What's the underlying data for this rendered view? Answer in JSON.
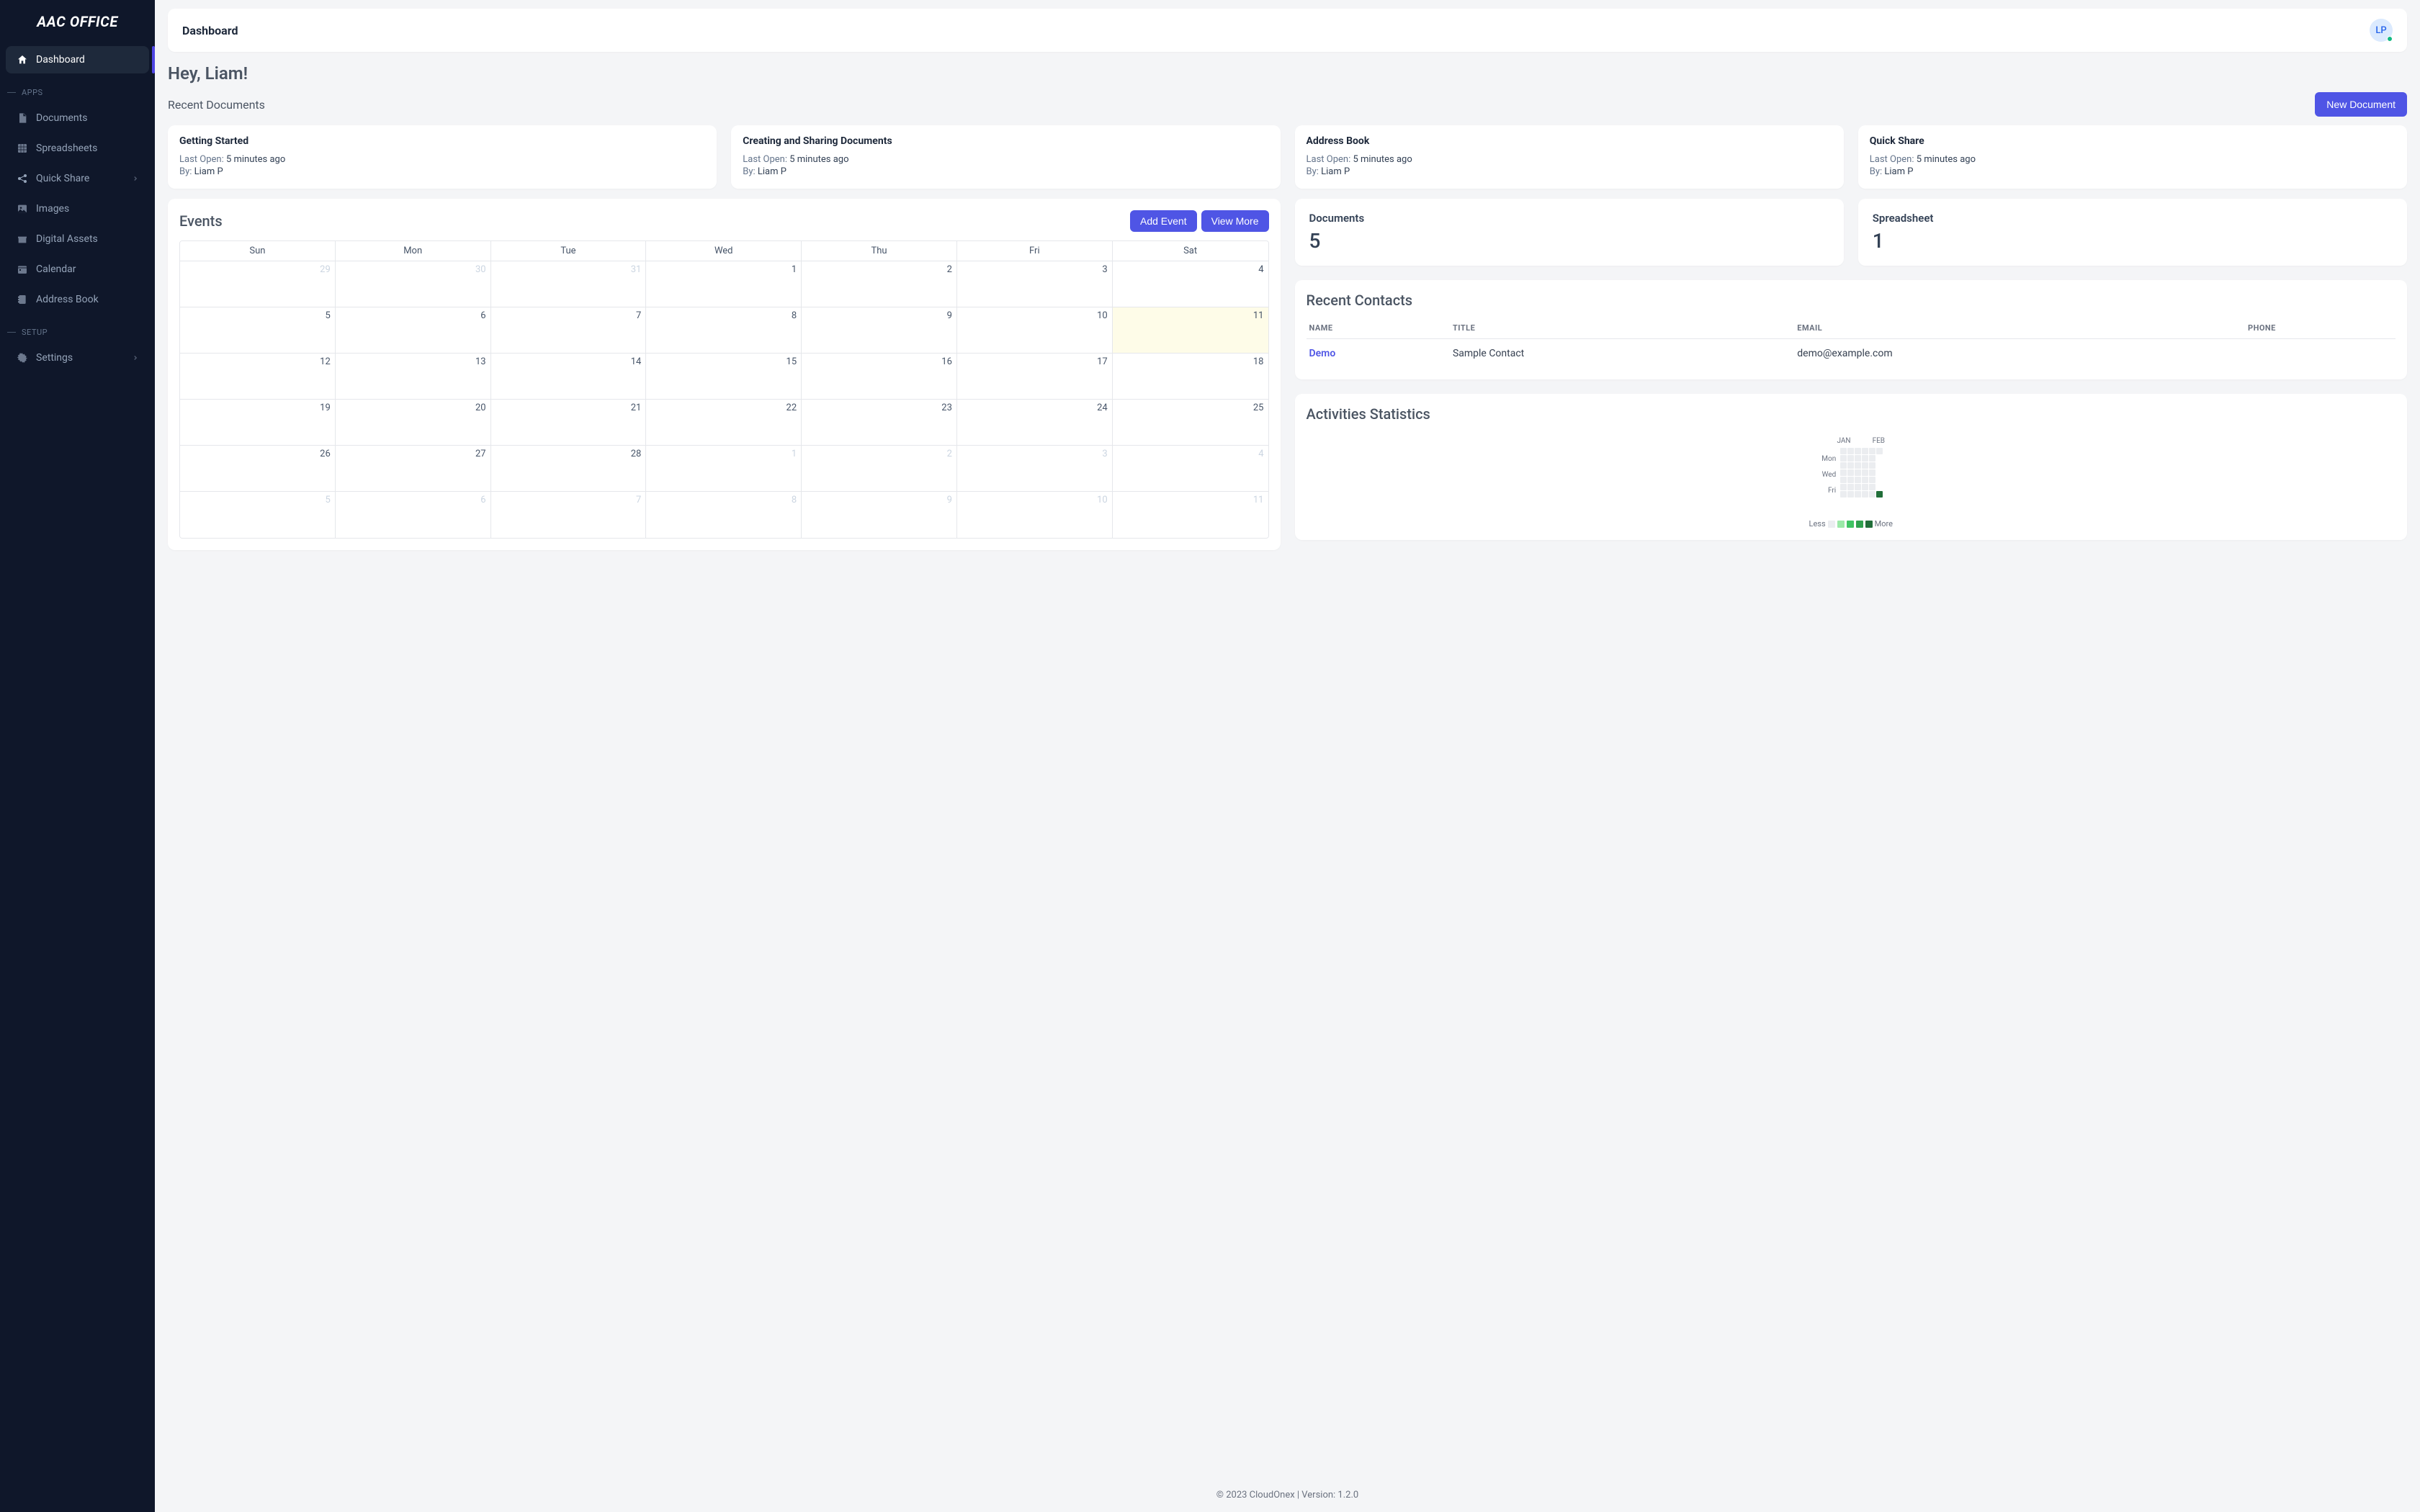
{
  "brand": "AAC OFFICE",
  "sidebar": {
    "active": {
      "label": "Dashboard"
    },
    "sections": {
      "apps": "APPS",
      "setup": "SETUP"
    },
    "items": {
      "documents": "Documents",
      "spreadsheets": "Spreadsheets",
      "quick_share": "Quick Share",
      "images": "Images",
      "digital_assets": "Digital Assets",
      "calendar": "Calendar",
      "address_book": "Address Book",
      "settings": "Settings"
    }
  },
  "topbar": {
    "title": "Dashboard",
    "avatar": "LP"
  },
  "greeting": "Hey, Liam!",
  "recent_docs": {
    "label": "Recent Documents",
    "new_btn": "New Document",
    "cards": [
      {
        "title": "Getting Started",
        "last_open_label": "Last Open:",
        "last_open": "5 minutes ago",
        "by_label": "By:",
        "by": "Liam P"
      },
      {
        "title": "Creating and Sharing Documents",
        "last_open_label": "Last Open:",
        "last_open": "5 minutes ago",
        "by_label": "By:",
        "by": "Liam P"
      },
      {
        "title": "Address Book",
        "last_open_label": "Last Open:",
        "last_open": "5 minutes ago",
        "by_label": "By:",
        "by": "Liam P"
      },
      {
        "title": "Quick Share",
        "last_open_label": "Last Open:",
        "last_open": "5 minutes ago",
        "by_label": "By:",
        "by": "Liam P"
      }
    ]
  },
  "events": {
    "title": "Events",
    "add_btn": "Add Event",
    "view_btn": "View More",
    "dow": [
      "Sun",
      "Mon",
      "Tue",
      "Wed",
      "Thu",
      "Fri",
      "Sat"
    ],
    "weeks": [
      [
        {
          "d": "29",
          "out": true
        },
        {
          "d": "30",
          "out": true
        },
        {
          "d": "31",
          "out": true
        },
        {
          "d": "1"
        },
        {
          "d": "2"
        },
        {
          "d": "3"
        },
        {
          "d": "4"
        }
      ],
      [
        {
          "d": "5"
        },
        {
          "d": "6"
        },
        {
          "d": "7"
        },
        {
          "d": "8"
        },
        {
          "d": "9"
        },
        {
          "d": "10"
        },
        {
          "d": "11",
          "today": true
        }
      ],
      [
        {
          "d": "12"
        },
        {
          "d": "13"
        },
        {
          "d": "14"
        },
        {
          "d": "15"
        },
        {
          "d": "16"
        },
        {
          "d": "17"
        },
        {
          "d": "18"
        }
      ],
      [
        {
          "d": "19"
        },
        {
          "d": "20"
        },
        {
          "d": "21"
        },
        {
          "d": "22"
        },
        {
          "d": "23"
        },
        {
          "d": "24"
        },
        {
          "d": "25"
        }
      ],
      [
        {
          "d": "26"
        },
        {
          "d": "27"
        },
        {
          "d": "28"
        },
        {
          "d": "1",
          "out": true
        },
        {
          "d": "2",
          "out": true
        },
        {
          "d": "3",
          "out": true
        },
        {
          "d": "4",
          "out": true
        }
      ],
      [
        {
          "d": "5",
          "out": true
        },
        {
          "d": "6",
          "out": true
        },
        {
          "d": "7",
          "out": true
        },
        {
          "d": "8",
          "out": true
        },
        {
          "d": "9",
          "out": true
        },
        {
          "d": "10",
          "out": true
        },
        {
          "d": "11",
          "out": true
        }
      ]
    ]
  },
  "stats": {
    "documents": {
      "label": "Documents",
      "value": "5"
    },
    "spreadsheet": {
      "label": "Spreadsheet",
      "value": "1"
    }
  },
  "contacts": {
    "title": "Recent Contacts",
    "headers": {
      "name": "NAME",
      "title": "TITLE",
      "email": "EMAIL",
      "phone": "PHONE"
    },
    "rows": [
      {
        "name": "Demo",
        "title": "Sample Contact",
        "email": "demo@example.com",
        "phone": ""
      }
    ]
  },
  "activities": {
    "title": "Activities Statistics",
    "months": [
      "JAN",
      "FEB"
    ],
    "day_labels": [
      "Mon",
      "Wed",
      "Fri"
    ],
    "legend": {
      "less": "Less",
      "more": "More"
    }
  },
  "footer": "© 2023 CloudOnex | Version: 1.2.0"
}
